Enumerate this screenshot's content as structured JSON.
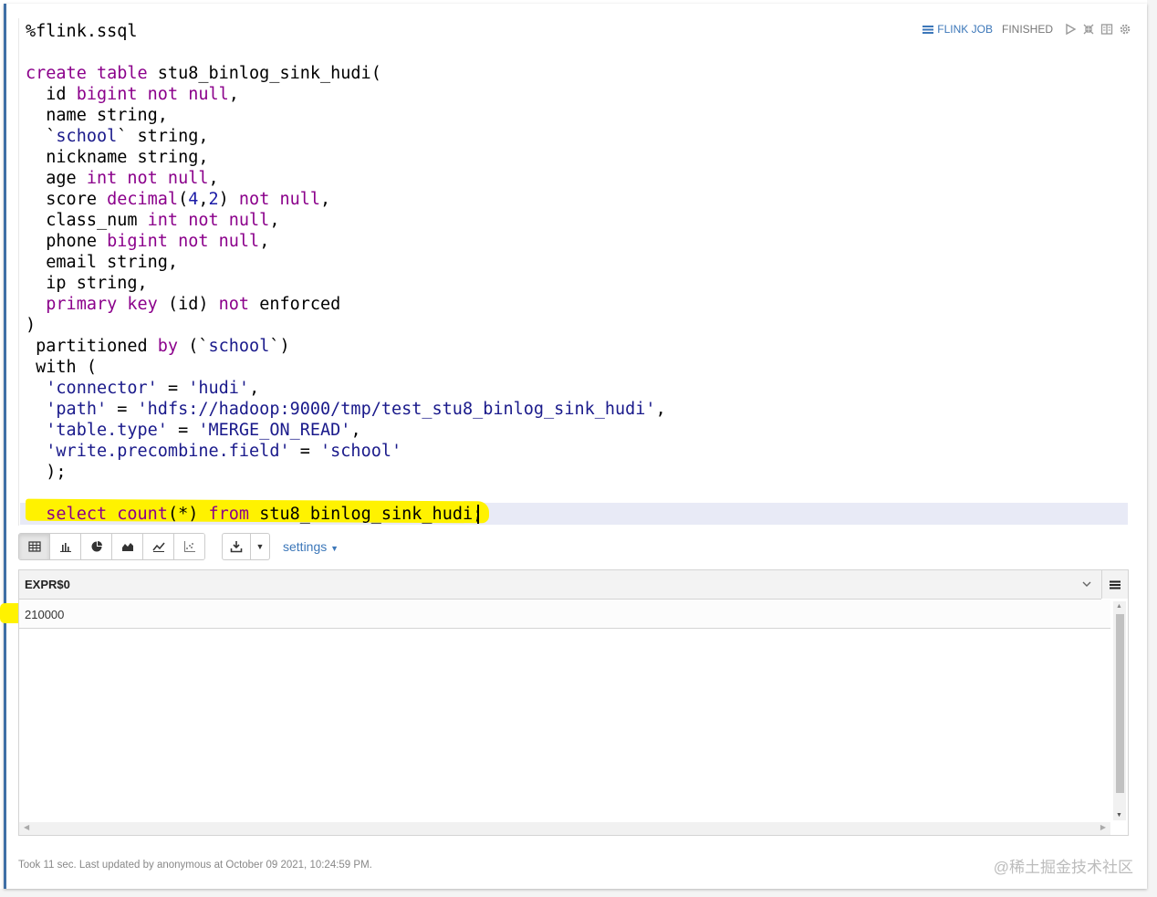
{
  "paragraph": {
    "interpreter": "%flink.ssql",
    "job_link_label": "FLINK JOB",
    "status": "FINISHED"
  },
  "code": {
    "lines": [
      [
        {
          "t": "create table",
          "c": "k"
        },
        {
          "t": " stu8_binlog_sink_hudi("
        }
      ],
      [
        {
          "t": "  id "
        },
        {
          "t": "bigint not null",
          "c": "k"
        },
        {
          "t": ","
        }
      ],
      [
        {
          "t": "  name string,"
        }
      ],
      [
        {
          "t": "  `"
        },
        {
          "t": "school",
          "c": "s"
        },
        {
          "t": "` string,"
        }
      ],
      [
        {
          "t": "  nickname string,"
        }
      ],
      [
        {
          "t": "  age "
        },
        {
          "t": "int not null",
          "c": "k"
        },
        {
          "t": ","
        }
      ],
      [
        {
          "t": "  score "
        },
        {
          "t": "decimal",
          "c": "k"
        },
        {
          "t": "("
        },
        {
          "t": "4",
          "c": "n"
        },
        {
          "t": ","
        },
        {
          "t": "2",
          "c": "n"
        },
        {
          "t": ") "
        },
        {
          "t": "not null",
          "c": "k"
        },
        {
          "t": ","
        }
      ],
      [
        {
          "t": "  class_num "
        },
        {
          "t": "int not null",
          "c": "k"
        },
        {
          "t": ","
        }
      ],
      [
        {
          "t": "  phone "
        },
        {
          "t": "bigint not null",
          "c": "k"
        },
        {
          "t": ","
        }
      ],
      [
        {
          "t": "  email string,"
        }
      ],
      [
        {
          "t": "  ip string,"
        }
      ],
      [
        {
          "t": "  "
        },
        {
          "t": "primary key",
          "c": "k"
        },
        {
          "t": " (id) "
        },
        {
          "t": "not",
          "c": "k"
        },
        {
          "t": " enforced"
        }
      ],
      [
        {
          "t": ")"
        }
      ],
      [
        {
          "t": " partitioned "
        },
        {
          "t": "by",
          "c": "k"
        },
        {
          "t": " (`"
        },
        {
          "t": "school",
          "c": "s"
        },
        {
          "t": "`)"
        }
      ],
      [
        {
          "t": " with ("
        }
      ],
      [
        {
          "t": "  "
        },
        {
          "t": "'connector'",
          "c": "s"
        },
        {
          "t": " = "
        },
        {
          "t": "'hudi'",
          "c": "s"
        },
        {
          "t": ","
        }
      ],
      [
        {
          "t": "  "
        },
        {
          "t": "'path'",
          "c": "s"
        },
        {
          "t": " = "
        },
        {
          "t": "'hdfs://hadoop:9000/tmp/test_stu8_binlog_sink_hudi'",
          "c": "s"
        },
        {
          "t": ","
        }
      ],
      [
        {
          "t": "  "
        },
        {
          "t": "'table.type'",
          "c": "s"
        },
        {
          "t": " = "
        },
        {
          "t": "'MERGE_ON_READ'",
          "c": "s"
        },
        {
          "t": ","
        }
      ],
      [
        {
          "t": "  "
        },
        {
          "t": "'write.precombine.field'",
          "c": "s"
        },
        {
          "t": " = "
        },
        {
          "t": "'school'",
          "c": "s"
        }
      ],
      [
        {
          "t": "  );"
        }
      ],
      [
        {
          "t": ""
        }
      ],
      [
        {
          "t": "  "
        },
        {
          "t": "select",
          "c": "k"
        },
        {
          "t": " "
        },
        {
          "t": "count",
          "c": "k"
        },
        {
          "t": "(*) "
        },
        {
          "t": "from",
          "c": "k"
        },
        {
          "t": " stu8_binlog_sink_hudi;"
        }
      ]
    ]
  },
  "toolbar": {
    "buttons": [
      "table-icon",
      "bar-chart-icon",
      "pie-chart-icon",
      "area-chart-icon",
      "line-chart-icon",
      "scatter-chart-icon"
    ],
    "settings_label": "settings"
  },
  "result": {
    "column": "EXPR$0",
    "rows": [
      [
        "210000"
      ]
    ]
  },
  "footer": "Took 11 sec. Last updated by anonymous at October 09 2021, 10:24:59 PM.",
  "watermark": "@稀土掘金技术社区",
  "colors": {
    "accent": "#3c77b9",
    "keyword": "#8b008b",
    "string": "#1a1a8b",
    "highlight": "#fff200"
  }
}
